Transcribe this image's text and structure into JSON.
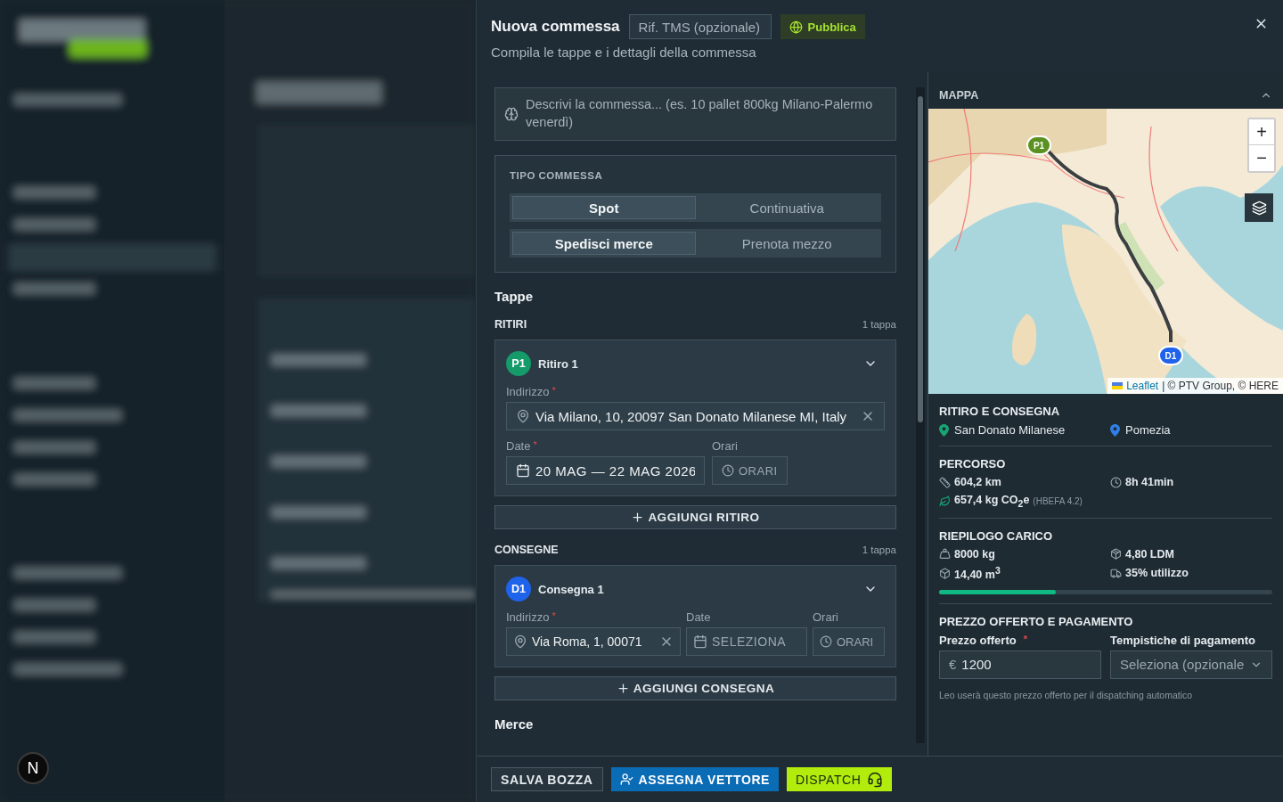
{
  "drawer": {
    "title": "Nuova commessa",
    "reference_placeholder": "Rif. TMS (opzionale)",
    "publish_button": "Pubblica",
    "subtitle": "Compila le tappe e i dettagli della commessa"
  },
  "description": {
    "placeholder": "Descrivi la commessa... (es. 10 pallet 800kg Milano-Palermo venerdì)"
  },
  "order_type": {
    "label": "TIPO COMMESSA",
    "groups": [
      {
        "options": [
          {
            "label": "Spot",
            "selected": true
          },
          {
            "label": "Continuativa",
            "selected": false
          }
        ]
      },
      {
        "options": [
          {
            "label": "Spedisci merce",
            "selected": true
          },
          {
            "label": "Prenota mezzo",
            "selected": false
          }
        ]
      }
    ]
  },
  "stops_heading": "Tappe",
  "stop_groups": [
    {
      "label": "RITIRI",
      "count": "1 tappa",
      "add_button": "AGGIUNGI RITIRO",
      "stops": [
        {
          "badge": "P1",
          "color": "#159a6a",
          "title": "Ritiro 1",
          "expanded": true,
          "kind": "stacked",
          "address_label": "Indirizzo",
          "address_required": "*",
          "address": "Via Milano, 10, 20097 San Donato Milanese MI, Italy",
          "date_label": "Date",
          "date_required": "*",
          "date": "20 MAG — 22 MAG 2026",
          "date_set": true,
          "time_label": "Orari",
          "time": "ORARI"
        }
      ]
    },
    {
      "label": "CONSEGNE",
      "count": "1 tappa",
      "add_button": "AGGIUNGI CONSEGNA",
      "stops": [
        {
          "badge": "D1",
          "color": "#1f63ea",
          "title": "Consegna 1",
          "expanded": true,
          "kind": "inline",
          "address_label": "Indirizzo",
          "address_required": "*",
          "address": "Via Roma, 1, 00071",
          "date_label": "Date",
          "date": "SELEZIONA",
          "date_set": false,
          "time_label": "Orari",
          "time": "ORARI"
        }
      ]
    }
  ],
  "goods_heading": "Merce",
  "map": {
    "title": "MAPPA",
    "expanded": true,
    "markers": [
      {
        "label": "P1",
        "color": "#5b9120"
      },
      {
        "label": "D1",
        "color": "#1f63ea"
      }
    ],
    "zoom_in": "+",
    "zoom_out": "−",
    "attribution_link": "Leaflet",
    "attribution": "| © PTV Group, © HERE"
  },
  "summary": {
    "places_title": "RITIRO E CONSEGNA",
    "places": [
      {
        "name": "San Donato Milanese",
        "color": "#17a673"
      },
      {
        "name": "Pomezia",
        "color": "#2f7fe8"
      }
    ],
    "route_title": "PERCORSO",
    "route": [
      {
        "kind": "distance",
        "value": "604,2 km"
      },
      {
        "kind": "duration",
        "value": "8h 41min"
      },
      {
        "kind": "emissions",
        "value": "657,4 kg CO$_{2}$e",
        "note": "(HBEFA 4.2)"
      }
    ],
    "load_title": "RIEPILOGO CARICO",
    "load": [
      {
        "kind": "weight",
        "value": "8000 kg"
      },
      {
        "kind": "ldm",
        "value": "4,80 LDM"
      },
      {
        "kind": "volume",
        "value": "14,40 m$^{3}$"
      },
      {
        "kind": "utilization",
        "value": "35% utilizzo"
      }
    ],
    "level": 0.35,
    "price_title": "PREZZO OFFERTO E PAGAMENTO",
    "price_label": "Prezzo offerto",
    "price_required": "*",
    "currency": "€",
    "price": "1200",
    "payment_label": "Tempistiche di pagamento",
    "payment_placeholder": "Seleziona (opzionale",
    "hint": "Leo userà questo prezzo offerto per il dispatching automatico"
  },
  "footer": {
    "buttons": [
      {
        "label": "SALVA BOZZA",
        "kind": "outline"
      },
      {
        "label": "ASSEGNA VETTORE",
        "kind": "primary"
      },
      {
        "label": "DISPATCH",
        "kind": "accent"
      }
    ]
  },
  "dev_badge": "N"
}
